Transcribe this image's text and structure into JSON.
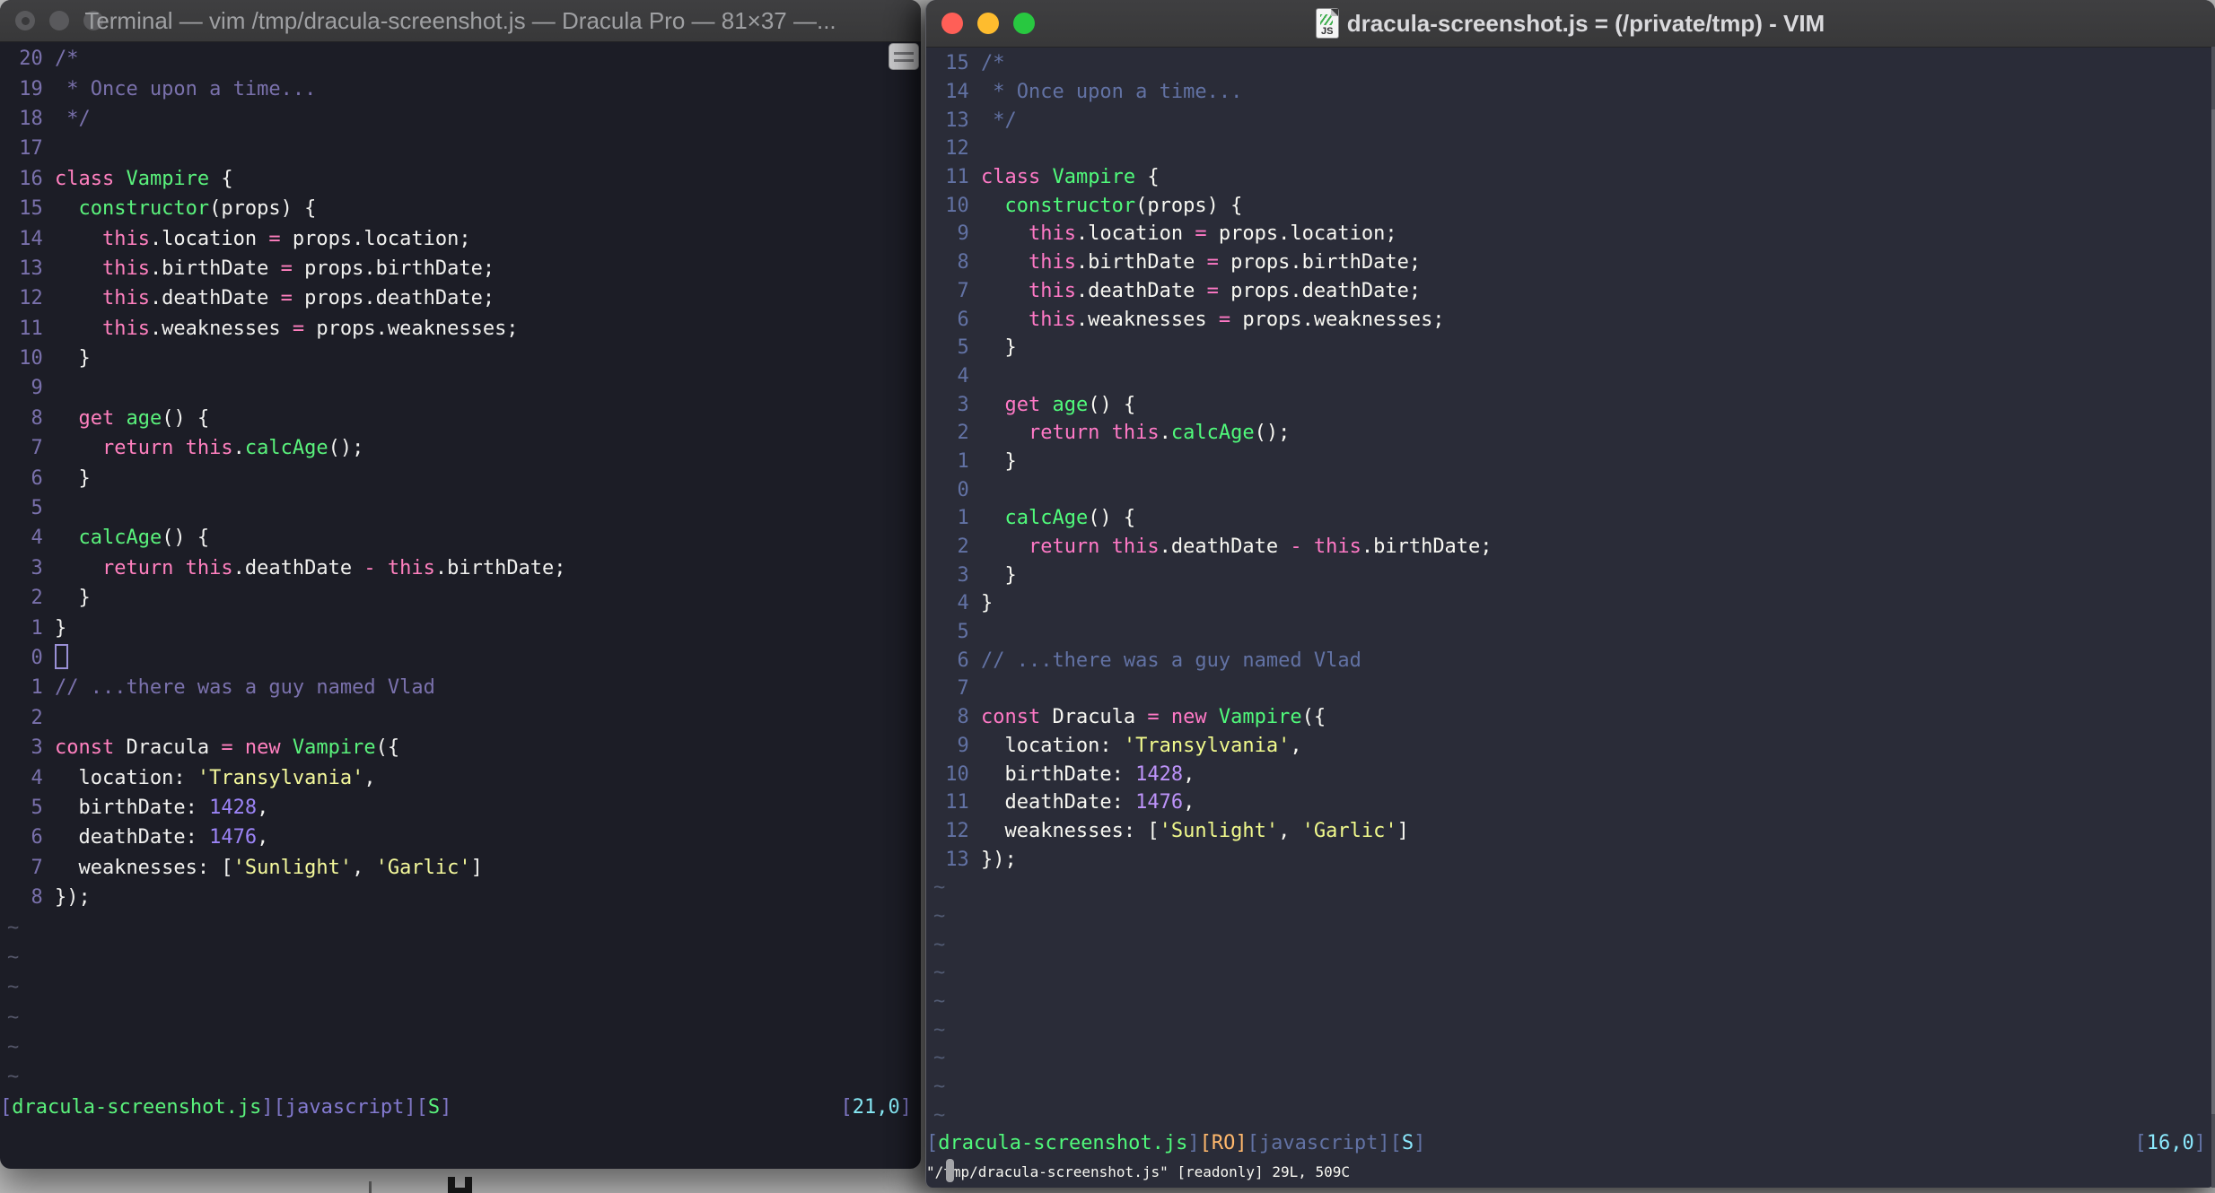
{
  "desktop": {
    "background": "#bfbfbf"
  },
  "left_window": {
    "title": "Terminal — vim /tmp/dracula-screenshot.js — Dracula Pro — 81×37 —...",
    "colors": {
      "bg": "#1c1d26",
      "fg": "#f1f1ef",
      "comment": "#7a71ac",
      "pink": "#ff80bf",
      "green": "#5af27c",
      "yellow": "#f5f99c",
      "purple": "#9c84f7",
      "cyan": "#86e8f4",
      "orange": "#ffca80",
      "tilde": "#545669",
      "lnum": "#7a71ac",
      "br": "#7d75c2",
      "jv": "#837ad0"
    },
    "lines": [
      {
        "n": "20",
        "t": [
          [
            "c",
            "/*"
          ]
        ]
      },
      {
        "n": "19",
        "t": [
          [
            "c",
            " * Once upon a time..."
          ]
        ]
      },
      {
        "n": "18",
        "t": [
          [
            "c",
            " */"
          ]
        ]
      },
      {
        "n": "17",
        "t": []
      },
      {
        "n": "16",
        "t": [
          [
            "k",
            "class "
          ],
          [
            "g",
            "Vampire"
          ],
          [
            "f",
            " {"
          ]
        ]
      },
      {
        "n": "15",
        "t": [
          [
            "f",
            "  "
          ],
          [
            "g",
            "constructor"
          ],
          [
            "f",
            "(props) {"
          ]
        ]
      },
      {
        "n": "14",
        "t": [
          [
            "f",
            "    "
          ],
          [
            "k",
            "this"
          ],
          [
            "f",
            ".location "
          ],
          [
            "k",
            "="
          ],
          [
            "f",
            " props.location;"
          ]
        ]
      },
      {
        "n": "13",
        "t": [
          [
            "f",
            "    "
          ],
          [
            "k",
            "this"
          ],
          [
            "f",
            ".birthDate "
          ],
          [
            "k",
            "="
          ],
          [
            "f",
            " props.birthDate;"
          ]
        ]
      },
      {
        "n": "12",
        "t": [
          [
            "f",
            "    "
          ],
          [
            "k",
            "this"
          ],
          [
            "f",
            ".deathDate "
          ],
          [
            "k",
            "="
          ],
          [
            "f",
            " props.deathDate;"
          ]
        ]
      },
      {
        "n": "11",
        "t": [
          [
            "f",
            "    "
          ],
          [
            "k",
            "this"
          ],
          [
            "f",
            ".weaknesses "
          ],
          [
            "k",
            "="
          ],
          [
            "f",
            " props.weaknesses;"
          ]
        ]
      },
      {
        "n": "10",
        "t": [
          [
            "f",
            "  }"
          ]
        ]
      },
      {
        "n": "9",
        "t": []
      },
      {
        "n": "8",
        "t": [
          [
            "f",
            "  "
          ],
          [
            "k",
            "get "
          ],
          [
            "g",
            "age"
          ],
          [
            "f",
            "() {"
          ]
        ]
      },
      {
        "n": "7",
        "t": [
          [
            "f",
            "    "
          ],
          [
            "k",
            "return "
          ],
          [
            "k",
            "this"
          ],
          [
            "f",
            "."
          ],
          [
            "g",
            "calcAge"
          ],
          [
            "f",
            "();"
          ]
        ]
      },
      {
        "n": "6",
        "t": [
          [
            "f",
            "  }"
          ]
        ]
      },
      {
        "n": "5",
        "t": []
      },
      {
        "n": "4",
        "t": [
          [
            "f",
            "  "
          ],
          [
            "g",
            "calcAge"
          ],
          [
            "f",
            "() {"
          ]
        ]
      },
      {
        "n": "3",
        "t": [
          [
            "f",
            "    "
          ],
          [
            "k",
            "return "
          ],
          [
            "k",
            "this"
          ],
          [
            "f",
            ".deathDate "
          ],
          [
            "k",
            "-"
          ],
          [
            "f",
            " "
          ],
          [
            "k",
            "this"
          ],
          [
            "f",
            ".birthDate;"
          ]
        ]
      },
      {
        "n": "2",
        "t": [
          [
            "f",
            "  }"
          ]
        ]
      },
      {
        "n": "1",
        "t": [
          [
            "f",
            "}"
          ]
        ]
      },
      {
        "n": "0",
        "t": [
          [
            "cur",
            ""
          ]
        ]
      },
      {
        "n": "1",
        "t": [
          [
            "c",
            "// ...there was a guy named Vlad"
          ]
        ]
      },
      {
        "n": "2",
        "t": []
      },
      {
        "n": "3",
        "t": [
          [
            "k",
            "const "
          ],
          [
            "f",
            "Dracula "
          ],
          [
            "k",
            "="
          ],
          [
            "f",
            " "
          ],
          [
            "k",
            "new "
          ],
          [
            "g",
            "Vampire"
          ],
          [
            "f",
            "({"
          ]
        ]
      },
      {
        "n": "4",
        "t": [
          [
            "f",
            "  location: "
          ],
          [
            "y",
            "'Transylvania'"
          ],
          [
            "f",
            ","
          ]
        ]
      },
      {
        "n": "5",
        "t": [
          [
            "f",
            "  birthDate: "
          ],
          [
            "p",
            "1428"
          ],
          [
            "f",
            ","
          ]
        ]
      },
      {
        "n": "6",
        "t": [
          [
            "f",
            "  deathDate: "
          ],
          [
            "p",
            "1476"
          ],
          [
            "f",
            ","
          ]
        ]
      },
      {
        "n": "7",
        "t": [
          [
            "f",
            "  weaknesses: ["
          ],
          [
            "y",
            "'Sunlight'"
          ],
          [
            "f",
            ", "
          ],
          [
            "y",
            "'Garlic'"
          ],
          [
            "f",
            "]"
          ]
        ]
      },
      {
        "n": "8",
        "t": [
          [
            "f",
            "});"
          ]
        ]
      },
      {
        "tilde": true
      },
      {
        "tilde": true
      },
      {
        "tilde": true
      },
      {
        "tilde": true
      },
      {
        "tilde": true
      },
      {
        "tilde": true
      }
    ],
    "status_left": [
      [
        "br",
        "["
      ],
      [
        "g",
        "dracula-screenshot.js"
      ],
      [
        "br",
        "]["
      ],
      [
        "jv",
        "javascript"
      ],
      [
        "br",
        "]["
      ],
      [
        "g",
        "S"
      ],
      [
        "br",
        "]"
      ]
    ],
    "status_right": [
      [
        "br",
        "["
      ],
      [
        "cy",
        "21,0"
      ],
      [
        "br",
        "]"
      ]
    ],
    "command_line": ""
  },
  "right_window": {
    "title": "dracula-screenshot.js = (/private/tmp) - VIM",
    "doc_icon_label": "JS",
    "colors": {
      "bg": "#2a2c38",
      "fg": "#f8f8f2",
      "comment": "#6272a4",
      "pink": "#ff79c6",
      "green": "#50fa7b",
      "yellow": "#f1fa8c",
      "purple": "#bd93f9",
      "cyan": "#8be9fd",
      "orange": "#ffb86c",
      "tilde": "#515a72",
      "lnum": "#6272a4",
      "br": "#6272a4",
      "jv": "#6272a4"
    },
    "lines": [
      {
        "n": "15",
        "t": [
          [
            "c",
            "/*"
          ]
        ]
      },
      {
        "n": "14",
        "t": [
          [
            "c",
            " * Once upon a time..."
          ]
        ]
      },
      {
        "n": "13",
        "t": [
          [
            "c",
            " */"
          ]
        ]
      },
      {
        "n": "12",
        "t": []
      },
      {
        "n": "11",
        "t": [
          [
            "k",
            "class "
          ],
          [
            "g",
            "Vampire"
          ],
          [
            "f",
            " {"
          ]
        ]
      },
      {
        "n": "10",
        "t": [
          [
            "f",
            "  "
          ],
          [
            "g",
            "constructor"
          ],
          [
            "f",
            "(props) {"
          ]
        ]
      },
      {
        "n": "9",
        "t": [
          [
            "f",
            "    "
          ],
          [
            "k",
            "this"
          ],
          [
            "f",
            ".location "
          ],
          [
            "k",
            "="
          ],
          [
            "f",
            " props.location;"
          ]
        ]
      },
      {
        "n": "8",
        "t": [
          [
            "f",
            "    "
          ],
          [
            "k",
            "this"
          ],
          [
            "f",
            ".birthDate "
          ],
          [
            "k",
            "="
          ],
          [
            "f",
            " props.birthDate;"
          ]
        ]
      },
      {
        "n": "7",
        "t": [
          [
            "f",
            "    "
          ],
          [
            "k",
            "this"
          ],
          [
            "f",
            ".deathDate "
          ],
          [
            "k",
            "="
          ],
          [
            "f",
            " props.deathDate;"
          ]
        ]
      },
      {
        "n": "6",
        "t": [
          [
            "f",
            "    "
          ],
          [
            "k",
            "this"
          ],
          [
            "f",
            ".weaknesses "
          ],
          [
            "k",
            "="
          ],
          [
            "f",
            " props.weaknesses;"
          ]
        ]
      },
      {
        "n": "5",
        "t": [
          [
            "f",
            "  }"
          ]
        ]
      },
      {
        "n": "4",
        "t": []
      },
      {
        "n": "3",
        "t": [
          [
            "f",
            "  "
          ],
          [
            "k",
            "get "
          ],
          [
            "g",
            "age"
          ],
          [
            "f",
            "() {"
          ]
        ]
      },
      {
        "n": "2",
        "t": [
          [
            "f",
            "    "
          ],
          [
            "k",
            "return "
          ],
          [
            "k",
            "this"
          ],
          [
            "f",
            "."
          ],
          [
            "g",
            "calcAge"
          ],
          [
            "f",
            "();"
          ]
        ]
      },
      {
        "n": "1",
        "t": [
          [
            "f",
            "  }"
          ]
        ]
      },
      {
        "n": "0",
        "t": []
      },
      {
        "n": "1",
        "t": [
          [
            "f",
            "  "
          ],
          [
            "g",
            "calcAge"
          ],
          [
            "f",
            "() {"
          ]
        ]
      },
      {
        "n": "2",
        "t": [
          [
            "f",
            "    "
          ],
          [
            "k",
            "return "
          ],
          [
            "k",
            "this"
          ],
          [
            "f",
            ".deathDate "
          ],
          [
            "k",
            "-"
          ],
          [
            "f",
            " "
          ],
          [
            "k",
            "this"
          ],
          [
            "f",
            ".birthDate;"
          ]
        ]
      },
      {
        "n": "3",
        "t": [
          [
            "f",
            "  }"
          ]
        ]
      },
      {
        "n": "4",
        "t": [
          [
            "f",
            "}"
          ]
        ]
      },
      {
        "n": "5",
        "t": []
      },
      {
        "n": "6",
        "t": [
          [
            "c",
            "// ...there was a guy named Vlad"
          ]
        ]
      },
      {
        "n": "7",
        "t": []
      },
      {
        "n": "8",
        "t": [
          [
            "k",
            "const "
          ],
          [
            "f",
            "Dracula "
          ],
          [
            "k",
            "="
          ],
          [
            "f",
            " "
          ],
          [
            "k",
            "new "
          ],
          [
            "g",
            "Vampire"
          ],
          [
            "f",
            "({"
          ]
        ]
      },
      {
        "n": "9",
        "t": [
          [
            "f",
            "  location: "
          ],
          [
            "y",
            "'Transylvania'"
          ],
          [
            "f",
            ","
          ]
        ]
      },
      {
        "n": "10",
        "t": [
          [
            "f",
            "  birthDate: "
          ],
          [
            "p",
            "1428"
          ],
          [
            "f",
            ","
          ]
        ]
      },
      {
        "n": "11",
        "t": [
          [
            "f",
            "  deathDate: "
          ],
          [
            "p",
            "1476"
          ],
          [
            "f",
            ","
          ]
        ]
      },
      {
        "n": "12",
        "t": [
          [
            "f",
            "  weaknesses: ["
          ],
          [
            "y",
            "'Sunlight'"
          ],
          [
            "f",
            ", "
          ],
          [
            "y",
            "'Garlic'"
          ],
          [
            "f",
            "]"
          ]
        ]
      },
      {
        "n": "13",
        "t": [
          [
            "f",
            "});"
          ]
        ]
      },
      {
        "tilde": true
      },
      {
        "tilde": true
      },
      {
        "tilde": true
      },
      {
        "tilde": true
      },
      {
        "tilde": true
      },
      {
        "tilde": true
      },
      {
        "tilde": true
      },
      {
        "tilde": true
      },
      {
        "tilde": true
      }
    ],
    "status_left": [
      [
        "br",
        "["
      ],
      [
        "g",
        "dracula-screenshot.js"
      ],
      [
        "br",
        "]"
      ],
      [
        "o",
        "[RO]"
      ],
      [
        "br",
        "["
      ],
      [
        "jv",
        "javascript"
      ],
      [
        "br",
        "]["
      ],
      [
        "cy",
        "S"
      ],
      [
        "br",
        "]"
      ]
    ],
    "status_right": [
      [
        "br",
        "["
      ],
      [
        "cy",
        "16,0"
      ],
      [
        "br",
        "]"
      ]
    ],
    "command_line": "\"/tmp/dracula-screenshot.js\" [readonly] 29L, 509C"
  }
}
